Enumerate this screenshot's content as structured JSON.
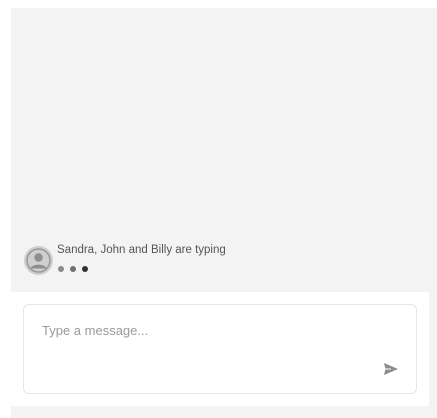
{
  "chat": {
    "typing_indicator": {
      "text": "Sandra, John and Billy are typing",
      "avatar_icon": "user-avatar-icon",
      "dot_colors": [
        "#8a8a8a",
        "#6f6f6f",
        "#333333"
      ]
    },
    "composer": {
      "placeholder": "Type a message...",
      "value": "",
      "send_icon": "send-icon"
    }
  },
  "colors": {
    "window_background": "#f3f3f3",
    "composer_border": "#e6e6e6",
    "icon_gray": "#8c8c8c"
  }
}
